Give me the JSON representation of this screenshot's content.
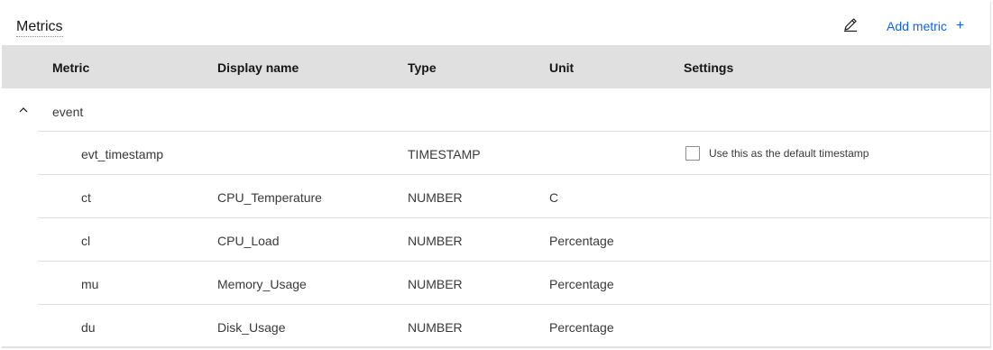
{
  "card": {
    "title": "Metrics",
    "edit_icon": "pencil-icon",
    "add_label": "Add metric",
    "add_icon": "+"
  },
  "table": {
    "headers": {
      "metric": "Metric",
      "display_name": "Display name",
      "type": "Type",
      "unit": "Unit",
      "settings": "Settings"
    },
    "group": {
      "name": "event",
      "expanded": true,
      "chevron_icon": "chevron-up-icon"
    },
    "rows": [
      {
        "metric": "evt_timestamp",
        "display_name": "",
        "type": "TIMESTAMP",
        "unit": "",
        "setting_label": "Use this as the default timestamp",
        "setting_checked": false
      },
      {
        "metric": "ct",
        "display_name": "CPU_Temperature",
        "type": "NUMBER",
        "unit": "C"
      },
      {
        "metric": "cl",
        "display_name": "CPU_Load",
        "type": "NUMBER",
        "unit": "Percentage"
      },
      {
        "metric": "mu",
        "display_name": "Memory_Usage",
        "type": "NUMBER",
        "unit": "Percentage"
      },
      {
        "metric": "du",
        "display_name": "Disk_Usage",
        "type": "NUMBER",
        "unit": "Percentage"
      }
    ]
  },
  "colors": {
    "accent": "#0f62fe",
    "header_bg": "#e0e0e0",
    "text": "#161616",
    "muted_text": "#393939"
  }
}
